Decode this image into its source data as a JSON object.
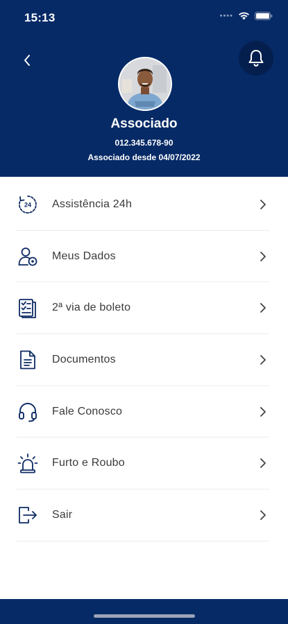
{
  "status_bar": {
    "time": "15:13"
  },
  "profile": {
    "name": "Associado",
    "id_number": "012.345.678-90",
    "member_since": "Associado desde 04/07/2022"
  },
  "menu": {
    "items": [
      {
        "label": "Assistência 24h",
        "icon": "clock-24h-icon"
      },
      {
        "label": "Meus Dados",
        "icon": "user-settings-icon"
      },
      {
        "label": "2ª via de boleto",
        "icon": "checklist-icon"
      },
      {
        "label": "Documentos",
        "icon": "document-icon"
      },
      {
        "label": "Fale Conosco",
        "icon": "headset-icon"
      },
      {
        "label": "Furto e Roubo",
        "icon": "alarm-siren-icon"
      },
      {
        "label": "Sair",
        "icon": "logout-icon"
      }
    ]
  },
  "colors": {
    "header_bg": "#062a66",
    "icon_color": "#0c2a63",
    "text_color": "#3a3a3a"
  }
}
